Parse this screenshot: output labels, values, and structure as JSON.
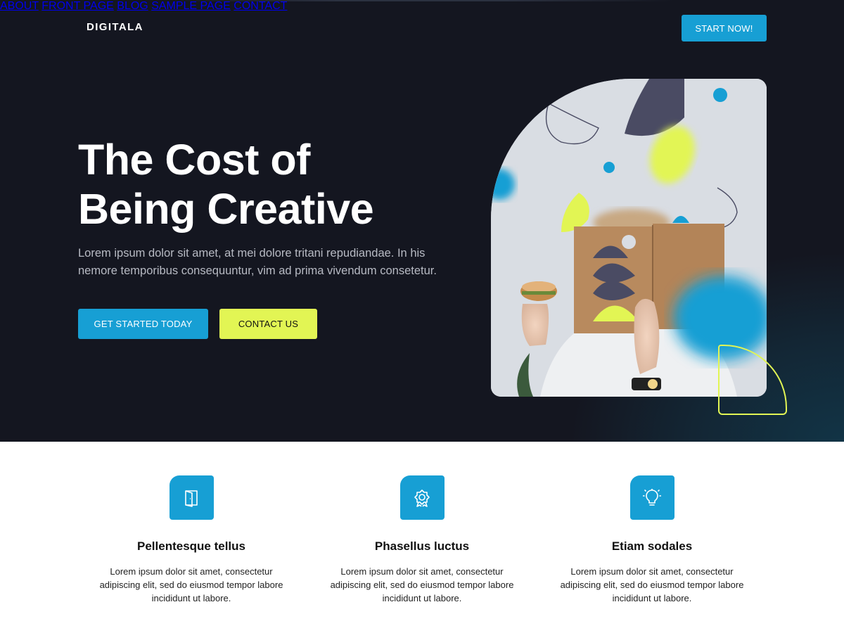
{
  "header": {
    "brand": "DIGITALA",
    "nav": [
      "ABOUT",
      "FRONT PAGE",
      "BLOG",
      "SAMPLE PAGE",
      "CONTACT"
    ],
    "cta": "START NOW!"
  },
  "hero": {
    "title_line1": "The Cost of",
    "title_line2": "Being Creative",
    "lead": "Lorem ipsum dolor sit amet, at mei dolore tritani repudiandae. In his nemore temporibus consequuntur, vim ad prima vivendum consetetur.",
    "primary_button": "GET STARTED TODAY",
    "secondary_button": "CONTACT US"
  },
  "features": [
    {
      "icon": "door-icon",
      "title": "Pellentesque tellus",
      "text": "Lorem ipsum dolor sit amet, consectetur adipiscing elit, sed do eiusmod tempor labore incididunt ut labore."
    },
    {
      "icon": "award-badge-icon",
      "title": "Phasellus luctus",
      "text": "Lorem ipsum dolor sit amet, consectetur adipiscing elit, sed do eiusmod tempor labore incididunt ut labore."
    },
    {
      "icon": "lightbulb-icon",
      "title": "Etiam sodales",
      "text": "Lorem ipsum dolor sit amet, consectetur adipiscing elit, sed do eiusmod tempor labore incididunt ut labore."
    }
  ],
  "colors": {
    "background_dark": "#141620",
    "accent_blue": "#179fd4",
    "accent_lime": "#e2f554",
    "shape_navy": "#4a4b63"
  }
}
